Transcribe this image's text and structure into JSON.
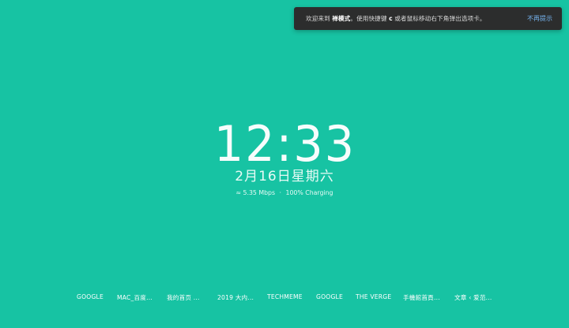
{
  "toast": {
    "prefix": "欢迎来到 ",
    "mode": "禅模式",
    "middle": "。使用快捷键 ",
    "key": "c",
    "suffix": " 或者鼠标移动右下角弹出选项卡。",
    "dismiss_label": "不再提示"
  },
  "clock": {
    "time": "12:33"
  },
  "date": {
    "text": "2月16日星期六"
  },
  "status": {
    "wifi_icon": "≈",
    "speed": "5.35 Mbps",
    "separator": "·",
    "battery": "100% Charging"
  },
  "shortcuts": [
    "GOOGLE",
    "MAC_百度...",
    "我的首页 ...",
    "2019 大内...",
    "TECHMEME",
    "GOOGLE",
    "THE VERGE",
    "手機館首頁...",
    "文章 ‹ 爱范..."
  ]
}
